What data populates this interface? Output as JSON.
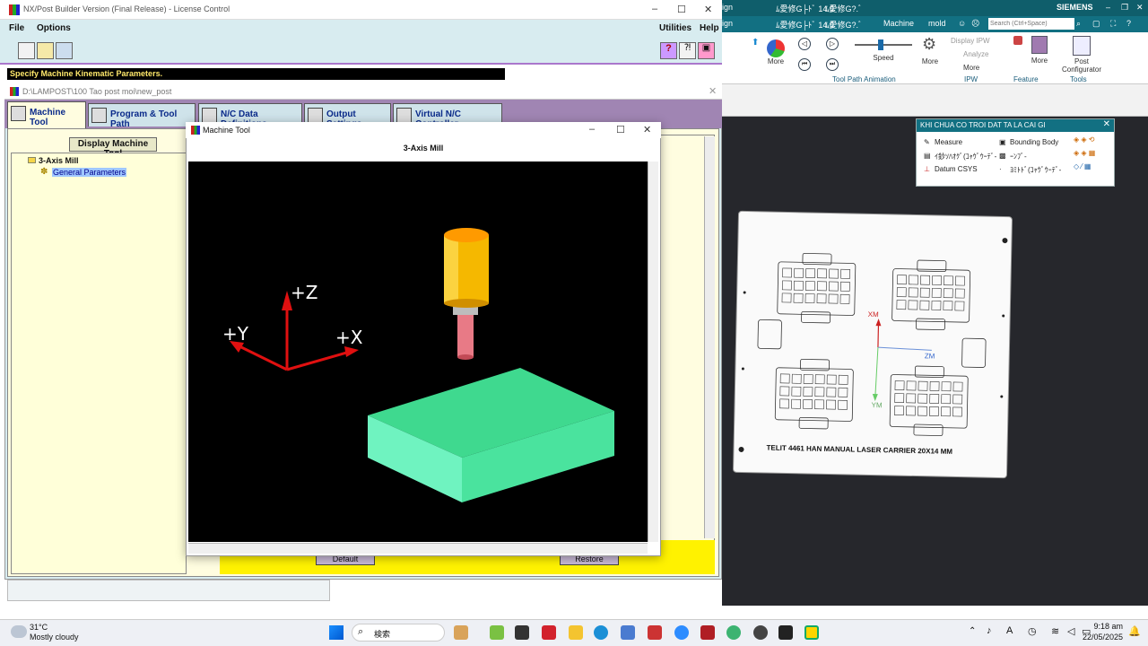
{
  "postbuilder": {
    "title": "NX/Post Builder Version (Final Release) - License Control",
    "menu": {
      "file": "File",
      "options": "Options",
      "utilities": "Utilities",
      "help": "Help"
    },
    "status": "Specify Machine Kinematic Parameters.",
    "subwindow_title": "D:\\LAMPOST\\100 Tao post moi\\new_post",
    "tabs": [
      "Machine Tool",
      "Program & Tool Path",
      "N/C Data Definitions",
      "Output Settings",
      "Virtual N/C Controller"
    ],
    "display_button": "Display Machine Tool",
    "tree": {
      "root": "3-Axis Mill",
      "child": "General Parameters"
    },
    "buttons": {
      "default": "Default",
      "restore": "Restore"
    }
  },
  "machine_tool": {
    "title": "Machine Tool",
    "heading": "3-Axis Mill",
    "axes": {
      "z": "+Z",
      "y": "+Y",
      "x": "+X"
    }
  },
  "nx": {
    "brand": "SIEMENS",
    "titlebar": [
      "ign",
      "ﾑ愛修G├ﾄﾞ 14.0",
      "ﾑ愛修G?.ﾞ",
      "Machine",
      "mold"
    ],
    "search_placeholder": "Search (Ctrl+Space)",
    "ribbon": {
      "more1": "More",
      "speed": "Speed",
      "more2": "More",
      "display_ipw": "Display IPW",
      "analyze": "Analyze",
      "more3": "More",
      "more4": "More",
      "post_configurator": "Post Configurator",
      "group_tool_path_animation": "Tool Path Animation",
      "group_ipw": "IPW",
      "group_feature": "Feature",
      "group_tools": "Tools"
    },
    "selection_panel": {
      "title": "KHI CHUA CO TROI DAT TA LA CAI GI",
      "items": [
        "Measure",
        "Bounding Body",
        "ｲ鈔ｿﾊｵｸﾞ(ｺｬｳﾞｳｰﾃﾞ-",
        "ｰﾝﾌﾞ-",
        "Datum CSYS",
        "ﾖﾐﾄﾄﾞ(ｺｬｳﾞｳｰﾃﾞ-"
      ]
    },
    "part": {
      "label": "TELIT 4461 HAN MANUAL LASER CARRIER 20X14  MM",
      "xm": "XM",
      "ym": "YM",
      "zm": "ZM"
    }
  },
  "taskbar": {
    "weather_temp": "31°C",
    "weather_desc": "Mostly cloudy",
    "search": "検索",
    "time": "9:18 am",
    "date": "22/05/2025"
  },
  "colors": {
    "nx_teal": "#127082",
    "pb_menu_bg": "#d8ecf0",
    "tab_bar": "#a085b3",
    "status_text": "#ffe96b",
    "block_green": "#3fd98f",
    "tool_orange": "#f5a400",
    "axis_red": "#e01010"
  }
}
